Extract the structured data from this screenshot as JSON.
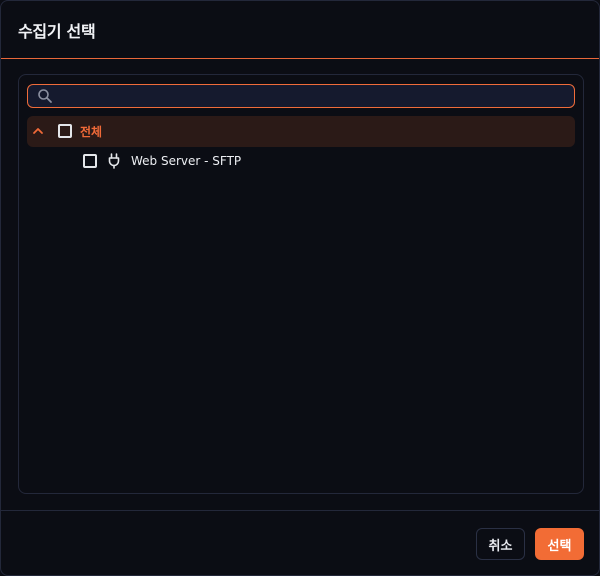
{
  "dialog": {
    "title": "수집기 선택"
  },
  "search": {
    "value": "",
    "placeholder": "",
    "icon": "search-icon"
  },
  "tree": {
    "root": {
      "label": "전체",
      "expanded": true,
      "checked": false,
      "icon": "chevron-up-icon"
    },
    "children": [
      {
        "label": "Web Server - SFTP",
        "checked": false,
        "icon": "plug-icon"
      }
    ]
  },
  "footer": {
    "cancel_label": "취소",
    "select_label": "선택"
  },
  "colors": {
    "accent": "#f26c35",
    "root_row_bg": "#2b1a17",
    "background": "#0b0d14",
    "border": "#23283a"
  }
}
